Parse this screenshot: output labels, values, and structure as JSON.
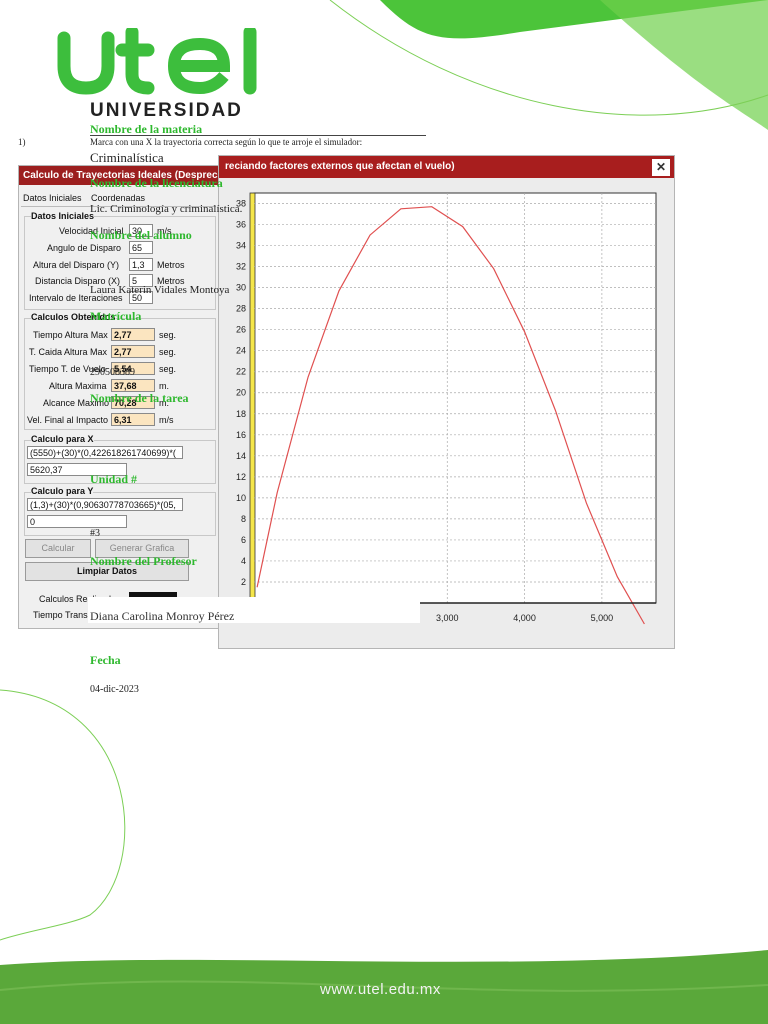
{
  "logo": {
    "brand": "utel",
    "subtitle": "UNIVERSIDAD",
    "color": "#3dbe3d"
  },
  "question": {
    "number": "1)",
    "text": "Marca con una X la trayectoria correcta según lo que te arroje el simulador:"
  },
  "info": {
    "materia_label": "Nombre de la materia",
    "materia_value": "Criminalística",
    "licenciatura_label": "Nombre de la licenciatura",
    "licenciatura_value": "Lic. Criminología y criminalística.",
    "alumno_label": "Nombre del alumno",
    "alumno_value": "Laura Katerin Vidales Montoya",
    "matricula_label": "Matrícula",
    "matricula_value": "290508389",
    "tarea_label": "Nombre de la tarea",
    "unidad_label": "Unidad #",
    "unidad_value": "#3",
    "profesor_label": "Nombre del Profesor",
    "profesor_value": "Diana Carolina Monroy Pérez",
    "fecha_label": "Fecha",
    "fecha_value": "04-dic-2023"
  },
  "simulator": {
    "title": "Calculo de Trayectorias Ideales (Despreciando factores externos que afectan el vuelo)",
    "right_title_fragment": "reciando factores externos que afectan el vuelo)",
    "tab1": "Datos Iniciales",
    "tab2": "Coordenadas",
    "datos_group": "Datos Iniciales",
    "velocidad_label": "Velocidad Inicial",
    "velocidad_value": "30",
    "velocidad_unit": "m/s",
    "angulo_label": "Angulo de Disparo",
    "angulo_value": "65",
    "altura_label": "Altura del Disparo (Y)",
    "altura_value": "1,3",
    "altura_unit": "Metros",
    "distancia_label": "Distancia Disparo (X)",
    "distancia_value": "5",
    "distancia_unit": "Metros",
    "intervalo_label": "Intervalo de Iteraciones",
    "intervalo_value": "50",
    "calculos_group": "Calculos Obtenidos",
    "tmax_label": "Tiempo Altura Max",
    "tmax_value": "2,77",
    "tmax_unit": "seg.",
    "tcaida_label": "T. Caida Altura Max",
    "tcaida_value": "2,77",
    "tcaida_unit": "seg.",
    "tvuelo_label": "Tiempo T. de Vuelo",
    "tvuelo_value": "5,54",
    "tvuelo_unit": "seg.",
    "hmax_label": "Altura Maxima",
    "hmax_value": "37,68",
    "hmax_unit": "m.",
    "alcance_label": "Alcance Maximo",
    "alcance_value": "70,28",
    "alcance_unit": "m.",
    "vfinal_label": "Vel. Final al Impacto",
    "vfinal_value": "6,31",
    "vfinal_unit": "m/s",
    "calcx_group": "Calculo para X",
    "calcx_formula": "(5550)+(30)*(0,422618261740699)*(",
    "calcx_result": "5620,37",
    "calcy_group": "Calculo para Y",
    "calcy_formula": "(1,3)+(30)*(0,90630778703665)*(05,",
    "calcy_result": "0",
    "calcular_btn": "Calcular",
    "grafica_btn": "Generar Grafica",
    "limpiar_btn": "Limpiar Datos",
    "realizados_label": "Calculos Realizados:",
    "transcurrido_label": "Tiempo Transcurrido:"
  },
  "chart_data": {
    "type": "line",
    "x_ticks": [
      "3,000",
      "4,000",
      "5,000"
    ],
    "y_ticks": [
      "2",
      "4",
      "6",
      "8",
      "10",
      "12",
      "14",
      "16",
      "18",
      "20",
      "22",
      "24",
      "26",
      "28",
      "30",
      "32",
      "34",
      "36",
      "38"
    ],
    "xlim": [
      500,
      5700
    ],
    "ylim": [
      0,
      39
    ],
    "series": [
      {
        "color": "#e05050",
        "x": [
          540,
          800,
          1200,
          1600,
          2000,
          2400,
          2800,
          3200,
          3600,
          4000,
          4400,
          4800,
          5200,
          5550
        ],
        "y": [
          1.5,
          10.5,
          21.5,
          29.7,
          35.0,
          37.5,
          37.7,
          35.8,
          31.8,
          25.8,
          18.3,
          9.5,
          2.5,
          -2.0
        ]
      }
    ],
    "grid": true
  },
  "footer": {
    "url": "www.utel.edu.mx",
    "color": "#5aaa3a"
  }
}
